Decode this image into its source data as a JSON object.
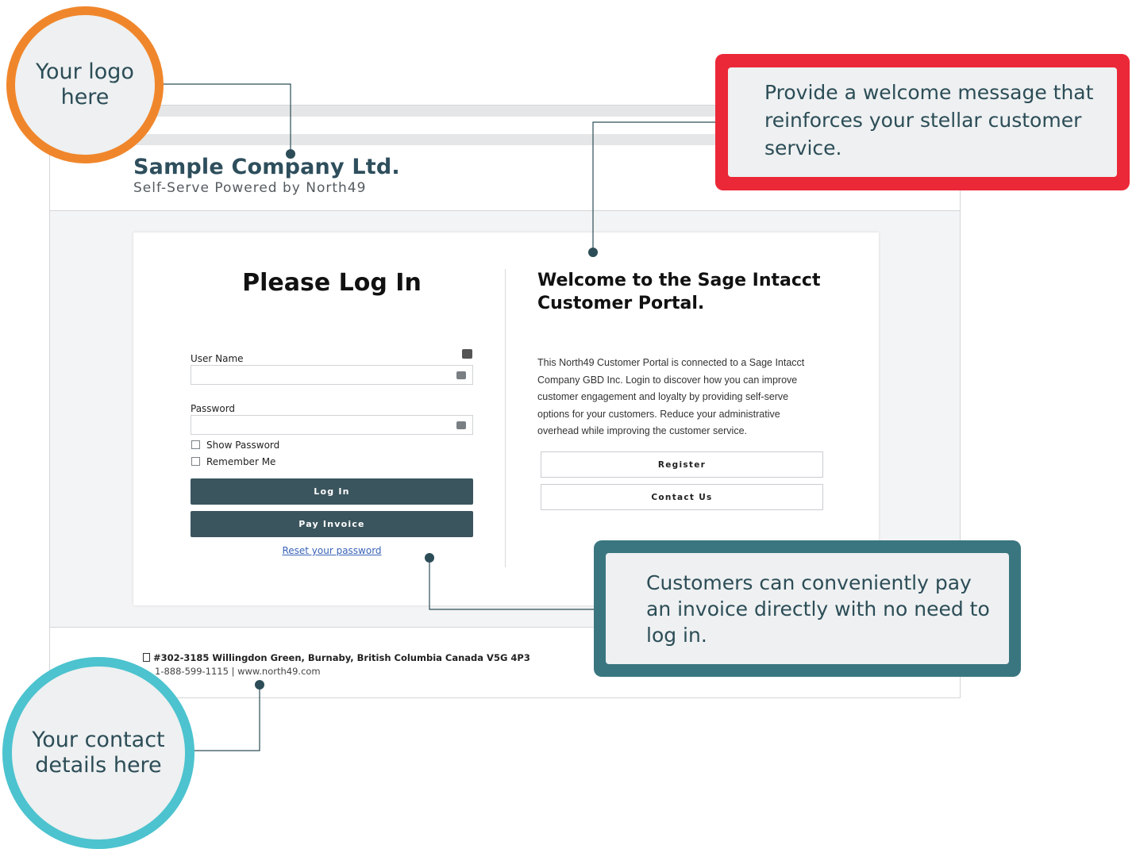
{
  "header": {
    "company_name": "Sample Company Ltd.",
    "tagline": "Self-Serve Powered by North49"
  },
  "login": {
    "title": "Please Log In",
    "username_label": "User Name",
    "username_value": "",
    "password_label": "Password",
    "password_value": "",
    "show_password_label": "Show Password",
    "remember_me_label": "Remember Me",
    "login_button": "Log In",
    "pay_invoice_button": "Pay Invoice",
    "reset_link": "Reset your password"
  },
  "welcome": {
    "title": "Welcome to the Sage Intacct Customer Portal.",
    "body": "This North49 Customer Portal is connected to a Sage Intacct Company GBD Inc. Login to discover how you can improve customer engagement and loyalty by providing self-serve options for your customers. Reduce your administrative overhead while improving the customer service.",
    "register_button": "Register",
    "contact_button": "Contact Us"
  },
  "footer": {
    "address": "#302-3185 Willingdon Green, Burnaby, British Columbia Canada V5G 4P3",
    "contact": "1-888-599-1115  |  www.north49.com"
  },
  "callouts": {
    "logo": "Your logo here",
    "welcome": "Provide a welcome message that reinforces your stellar customer service.",
    "pay_invoice": "Customers can conveniently pay an invoice directly with no need to log in.",
    "contact": "Your contact details here"
  },
  "colors": {
    "brand_dark": "#3b555e",
    "logo_ring": "#f0862b",
    "welcome_frame": "#eb2838",
    "pay_frame": "#3a7680",
    "contact_ring": "#4cc3cf"
  }
}
